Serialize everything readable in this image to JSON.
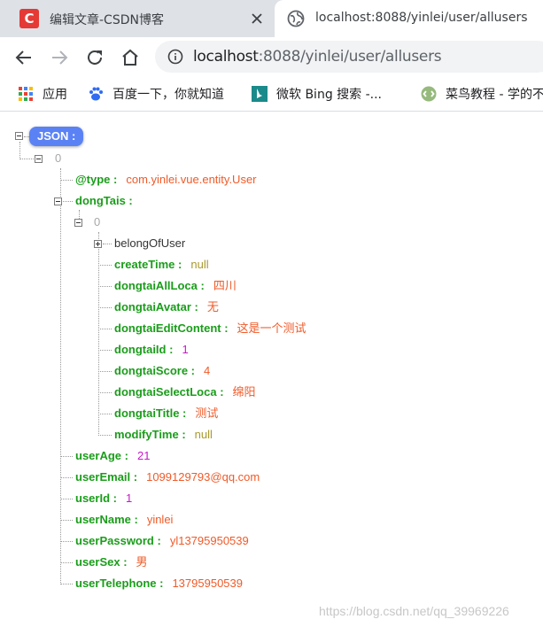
{
  "browser": {
    "tabs": [
      {
        "title": "编辑文章-CSDN博客",
        "active": false,
        "favicon": "csdn-logo-icon"
      },
      {
        "title": "localhost:8088/yinlei/user/allusers",
        "active": true,
        "favicon": "globe-icon"
      }
    ],
    "url": {
      "host": "localhost",
      "rest": ":8088/yinlei/user/allusers"
    },
    "bookmarks": [
      {
        "label": "应用",
        "icon": "apps-grid-icon"
      },
      {
        "label": "百度一下，你就知道",
        "icon": "baidu-paw-icon"
      },
      {
        "label": "微软 Bing 搜索 -...",
        "icon": "bing-icon"
      },
      {
        "label": "菜鸟教程 - 学的不",
        "icon": "runoob-icon"
      }
    ]
  },
  "json_viewer": {
    "root_label": "JSON :",
    "index0": "0",
    "user_fields": {
      "type": {
        "key": "@type :",
        "value": "com.yinlei.vue.entity.User"
      },
      "dongTais": {
        "key": "dongTais :"
      },
      "userAge": {
        "key": "userAge :",
        "value": "21"
      },
      "userEmail": {
        "key": "userEmail :",
        "value": "1099129793@qq.com"
      },
      "userId": {
        "key": "userId :",
        "value": "1"
      },
      "userName": {
        "key": "userName :",
        "value": "yinlei"
      },
      "userPassword": {
        "key": "userPassword :",
        "value": "yl13795950539"
      },
      "userSex": {
        "key": "userSex :",
        "value": "男"
      },
      "userTelephone": {
        "key": "userTelephone :",
        "value": "13795950539"
      }
    },
    "dongtai_index": "0",
    "dongtai_fields": {
      "belongOfUser": {
        "key": "belongOfUser"
      },
      "createTime": {
        "key": "createTime :",
        "value": "null"
      },
      "dongtaiAllLoca": {
        "key": "dongtaiAllLoca :",
        "value": "四川"
      },
      "dongtaiAvatar": {
        "key": "dongtaiAvatar :",
        "value": "无"
      },
      "dongtaiEditContent": {
        "key": "dongtaiEditContent :",
        "value": "这是一个测试"
      },
      "dongtaiId": {
        "key": "dongtaiId :",
        "value": "1"
      },
      "dongtaiScore": {
        "key": "dongtaiScore :",
        "value": "4"
      },
      "dongtaiSelectLoca": {
        "key": "dongtaiSelectLoca :",
        "value": "绵阳"
      },
      "dongtaiTitle": {
        "key": "dongtaiTitle :",
        "value": "测试"
      },
      "modifyTime": {
        "key": "modifyTime :",
        "value": "null"
      }
    }
  },
  "watermark": "https://blog.csdn.net/qq_39969226",
  "colors": {
    "key": "#1a9d1a",
    "string": "#f05a28",
    "number": "#c716c7",
    "null": "#a89a2a",
    "root_badge": "#5b82f5"
  }
}
